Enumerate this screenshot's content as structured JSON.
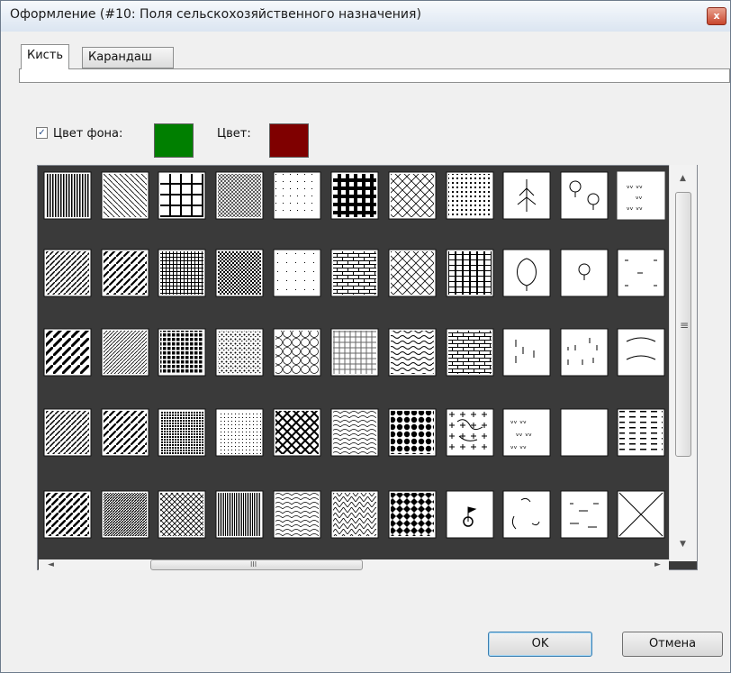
{
  "window": {
    "title": "Оформление (#10: Поля сельскохозяйственного назначения)",
    "close_glyph": "x"
  },
  "tabs": [
    {
      "label": "Кисть",
      "active": true
    },
    {
      "label": "Карандаш",
      "active": false
    }
  ],
  "background_color": {
    "checkbox_label": "Цвет фона:",
    "checked": true,
    "value": "#007f00"
  },
  "color": {
    "label": "Цвет:",
    "value": "#7f0000"
  },
  "patterns": [
    "vertical-lines-dense",
    "diagonal-lines-fine",
    "grid-large",
    "crosshatch-diagonal-fine",
    "dots-sparse",
    "brick-grid",
    "scales",
    "dots-dense",
    "conifer-forest",
    "deciduous-trees",
    "meadow-marks",
    "diagonal-lines-wide",
    "diagonal-lines-bold",
    "grid-fine",
    "checker-fine",
    "dots-grid-sparse",
    "brick-horizontal",
    "scales-wave",
    "vertical-brick",
    "deciduous-forest",
    "deciduous-tree-single",
    "grass-marks",
    "diagonal-lines-thick",
    "diagonal-lines-medium",
    "dot-grid-bold",
    "dots-random",
    "circles",
    "plus-grid",
    "waves-horizontal",
    "brick-large",
    "conifer-sparse",
    "grass-tufts",
    "wavy-marks",
    "diagonal-lines-bold-fine",
    "diagonal-lines-dense",
    "dense-grid",
    "dots-fine",
    "weave",
    "scales-diagonal",
    "circles-bold",
    "crosses",
    "trees-mixed",
    "meadow-wavy",
    "horizontal-dashes",
    "diagonal-lines-heavy",
    "diagonal-lines-heavy-dense",
    "diagonal-crosshatch",
    "vertical-lines-fine",
    "scales-bold",
    "zigzag",
    "diamonds",
    "flag-symbol",
    "trees-curved",
    "grass-dashes",
    "diagonal-cross"
  ],
  "selected_pattern": 10,
  "scroll_glyphs": {
    "up": "▲",
    "down": "▼",
    "left": "◄",
    "right": "►",
    "vgrip": "≡",
    "hgrip": "III"
  },
  "buttons": {
    "ok": "OK",
    "cancel": "Отмена"
  }
}
